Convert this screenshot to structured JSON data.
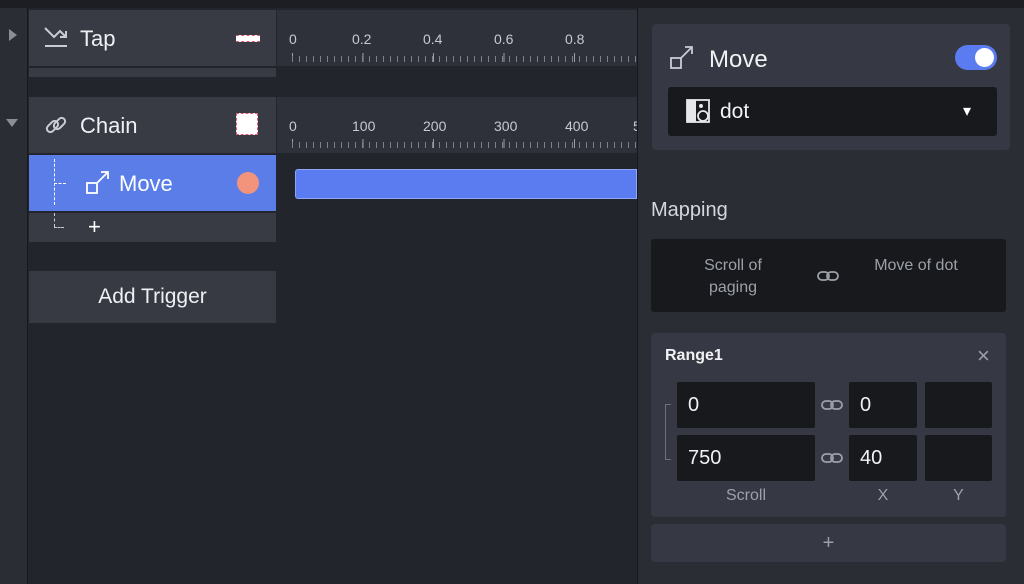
{
  "layers": [
    {
      "name": "Tap",
      "icon": "tap-icon",
      "collapsed": true
    },
    {
      "name": "Chain",
      "icon": "chain-link-icon",
      "collapsed": false
    },
    {
      "name": "Move",
      "icon": "move-icon",
      "selected": true
    }
  ],
  "add_row_symbol": "+",
  "add_trigger_label": "Add Trigger",
  "ruler_tap": [
    "0",
    "0.2",
    "0.4",
    "0.6",
    "0.8"
  ],
  "ruler_chain": [
    "0",
    "100",
    "200",
    "300",
    "400",
    "5"
  ],
  "colors": {
    "accent": "#5b7cf0",
    "selection": "#5a7de8",
    "move_dot": "#f2937b",
    "track_bar": "#5b7cf0"
  },
  "inspector": {
    "title": "Move",
    "title_icon": "move-icon",
    "enabled": true,
    "target": {
      "value": "dot",
      "icon": "image-layer-icon",
      "caret": "▾"
    },
    "mapping_heading": "Mapping",
    "mapping_from": "Scroll of paging",
    "mapping_to": "Move of dot",
    "range": {
      "title": "Range1",
      "close": "×",
      "rows": [
        {
          "scroll": "0",
          "x": "0",
          "y": ""
        },
        {
          "scroll": "750",
          "x": "40",
          "y": ""
        }
      ],
      "col_labels": {
        "scroll": "Scroll",
        "x": "X",
        "y": "Y"
      }
    },
    "add_range": "+"
  }
}
